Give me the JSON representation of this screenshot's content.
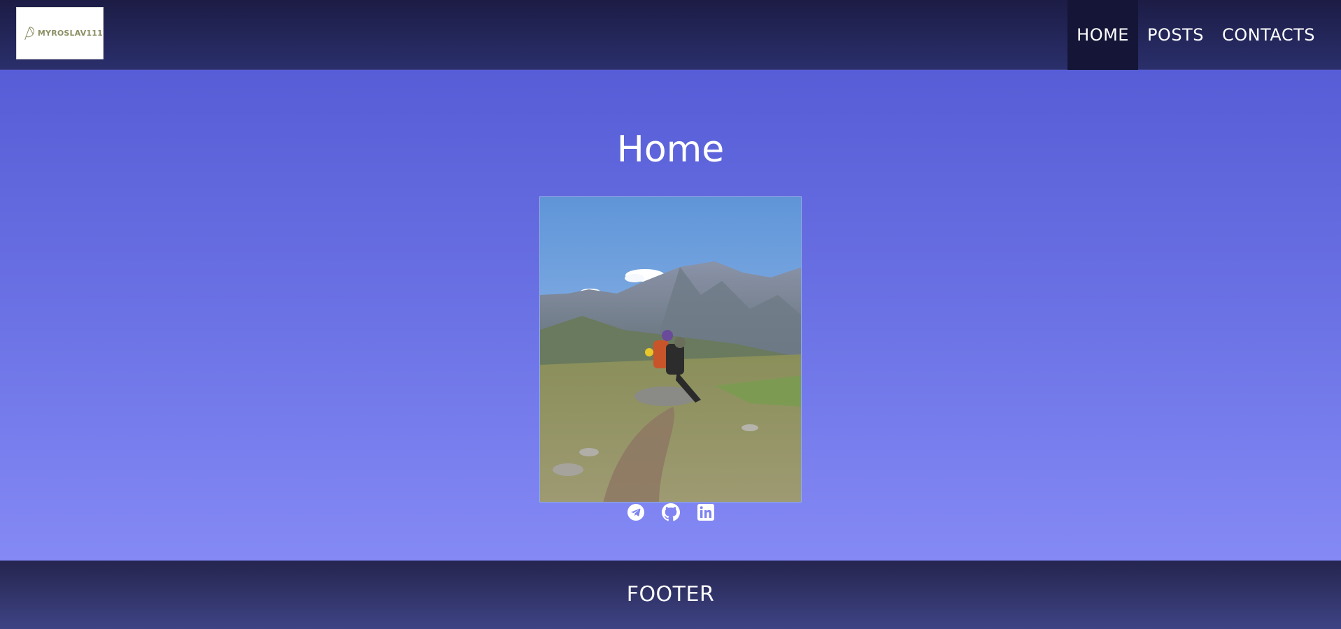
{
  "header": {
    "logo": {
      "text": "MYROSLAV111"
    },
    "nav": [
      {
        "label": "HOME",
        "active": true
      },
      {
        "label": "POSTS",
        "active": false
      },
      {
        "label": "CONTACTS",
        "active": false
      }
    ]
  },
  "main": {
    "title": "Home",
    "social": [
      {
        "icon": "telegram-icon"
      },
      {
        "icon": "github-icon"
      },
      {
        "icon": "linkedin-icon"
      }
    ]
  },
  "footer": {
    "label": "FOOTER"
  },
  "colors": {
    "header_bg": "#1c1c45",
    "nav_active_bg": "#151537",
    "main_top": "#575dd6",
    "main_bottom": "#8489f5",
    "footer_bg": "#25254f",
    "logo_text": "#8c8f64"
  }
}
